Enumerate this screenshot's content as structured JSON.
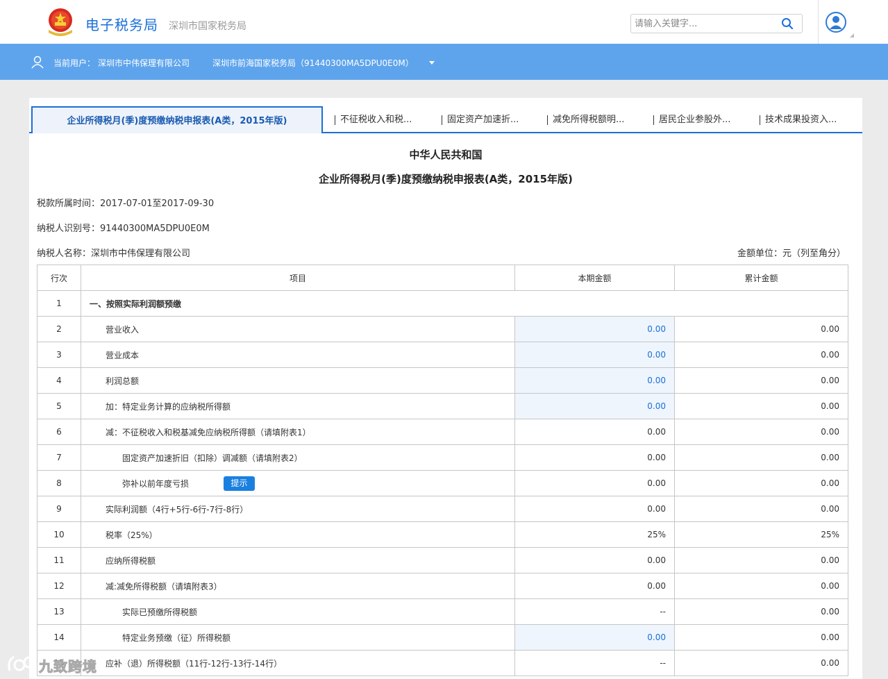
{
  "header": {
    "logo_title": "电子税务局",
    "logo_subtitle": "深圳市国家税务局",
    "search_placeholder": "请输入关键字...",
    "brand_color": "#1a6fd8"
  },
  "userbar": {
    "current_user_label": "当前用户：",
    "current_user": "深圳市中伟保理有限公司",
    "tax_bureau": "深圳市前海国家税务局（91440300MA5DPU0E0M）",
    "bar_color": "#5ea4ec"
  },
  "tabs": [
    {
      "label": "企业所得税月(季)度预缴纳税申报表(A类，2015年版)",
      "active": true
    },
    {
      "label": "不征税收入和税...",
      "active": false
    },
    {
      "label": "固定资产加速折...",
      "active": false
    },
    {
      "label": "减免所得税额明...",
      "active": false
    },
    {
      "label": "居民企业参股外...",
      "active": false
    },
    {
      "label": "技术成果投资入...",
      "active": false
    }
  ],
  "document": {
    "title1": "中华人民共和国",
    "title2": "企业所得税月(季)度预缴纳税申报表(A类，2015年版)",
    "period": "税款所属时间：2017-07-01至2017-09-30",
    "taxpayer_id": "纳税人识别号：91440300MA5DPU0E0M",
    "taxpayer_name": "纳税人名称：深圳市中伟保理有限公司",
    "unit": "金额单位：元（列至角分）"
  },
  "table": {
    "headers": [
      "行次",
      "项目",
      "本期金额",
      "累计金额"
    ],
    "hint_label": "提示",
    "rows": [
      {
        "no": "1",
        "item": "一、按照实际利润额预缴",
        "current": "",
        "cumulative": "",
        "indent": 0,
        "bold": true,
        "editable": false
      },
      {
        "no": "2",
        "item": "营业收入",
        "current": "0.00",
        "cumulative": "0.00",
        "indent": 1,
        "editable": true
      },
      {
        "no": "3",
        "item": "营业成本",
        "current": "0.00",
        "cumulative": "0.00",
        "indent": 1,
        "editable": true
      },
      {
        "no": "4",
        "item": "利润总额",
        "current": "0.00",
        "cumulative": "0.00",
        "indent": 1,
        "editable": true
      },
      {
        "no": "5",
        "item": "加：特定业务计算的应纳税所得额",
        "current": "0.00",
        "cumulative": "0.00",
        "indent": 1,
        "editable": true
      },
      {
        "no": "6",
        "item": "减：不征税收入和税基减免应纳税所得额（请填附表1）",
        "current": "0.00",
        "cumulative": "0.00",
        "indent": 1,
        "editable": false
      },
      {
        "no": "7",
        "item": "固定资产加速折旧（扣除）调减额（请填附表2）",
        "current": "0.00",
        "cumulative": "0.00",
        "indent": 2,
        "editable": false
      },
      {
        "no": "8",
        "item": "弥补以前年度亏损",
        "current": "0.00",
        "cumulative": "0.00",
        "indent": 2,
        "editable": false,
        "hint": true
      },
      {
        "no": "9",
        "item": "实际利润额（4行+5行-6行-7行-8行）",
        "current": "0.00",
        "cumulative": "0.00",
        "indent": 1,
        "editable": false
      },
      {
        "no": "10",
        "item": "税率（25%）",
        "current": "25%",
        "cumulative": "25%",
        "indent": 1,
        "editable": false
      },
      {
        "no": "11",
        "item": "应纳所得税额",
        "current": "0.00",
        "cumulative": "0.00",
        "indent": 1,
        "editable": false
      },
      {
        "no": "12",
        "item": "减:减免所得税额（请填附表3）",
        "current": "0.00",
        "cumulative": "0.00",
        "indent": 1,
        "editable": false
      },
      {
        "no": "13",
        "item": "实际已预缴所得税额",
        "current": "--",
        "cumulative": "0.00",
        "indent": 2,
        "editable": false
      },
      {
        "no": "14",
        "item": "特定业务预缴（征）所得税额",
        "current": "0.00",
        "cumulative": "0.00",
        "indent": 2,
        "editable": true
      },
      {
        "no": "15",
        "item": "应补（退）所得税额（11行-12行-13行-14行）",
        "current": "--",
        "cumulative": "0.00",
        "indent": 1,
        "editable": false
      }
    ]
  },
  "watermark": {
    "text": "九致跨境"
  }
}
